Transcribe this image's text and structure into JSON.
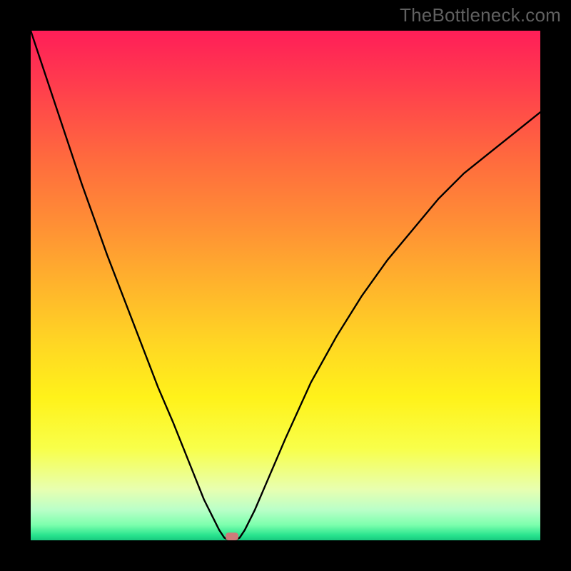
{
  "meta": {
    "watermark": "TheBottleneck.com"
  },
  "chart_data": {
    "type": "line",
    "title": "",
    "xlabel": "",
    "ylabel": "",
    "xlim": [
      0,
      100
    ],
    "ylim": [
      0,
      100
    ],
    "grid": false,
    "legend": false,
    "background_gradient": {
      "direction": "vertical",
      "stops": [
        {
          "pos": 0.0,
          "color": "#ff1e58"
        },
        {
          "pos": 0.1,
          "color": "#ff3b4e"
        },
        {
          "pos": 0.25,
          "color": "#ff6a3e"
        },
        {
          "pos": 0.38,
          "color": "#ff8f35"
        },
        {
          "pos": 0.5,
          "color": "#ffb42c"
        },
        {
          "pos": 0.62,
          "color": "#ffd823"
        },
        {
          "pos": 0.72,
          "color": "#fff21a"
        },
        {
          "pos": 0.82,
          "color": "#f8ff4a"
        },
        {
          "pos": 0.9,
          "color": "#e8ffb0"
        },
        {
          "pos": 0.94,
          "color": "#baffc8"
        },
        {
          "pos": 0.97,
          "color": "#7cffad"
        },
        {
          "pos": 0.99,
          "color": "#28e38e"
        },
        {
          "pos": 1.0,
          "color": "#18c97f"
        }
      ]
    },
    "series": [
      {
        "name": "bottleneck-curve",
        "color": "#000000",
        "stroke_width": 2.4,
        "x": [
          0,
          5,
          10,
          15,
          20,
          25,
          28,
          30,
          32,
          34,
          36,
          37,
          38,
          39,
          40,
          41,
          42,
          44,
          47,
          50,
          55,
          60,
          65,
          70,
          75,
          80,
          85,
          90,
          95,
          100
        ],
        "y": [
          100,
          85,
          70,
          56,
          43,
          30,
          23,
          18,
          13,
          8,
          4,
          2,
          0.5,
          0,
          0,
          0.5,
          2,
          6,
          13,
          20,
          31,
          40,
          48,
          55,
          61,
          67,
          72,
          76,
          80,
          84
        ]
      }
    ],
    "markers": [
      {
        "name": "bottleneck-point",
        "shape": "rounded-rect",
        "color": "#cd7a7a",
        "x": 39.5,
        "y": 0,
        "width_pct": 2.5,
        "height_pct": 1.5
      }
    ]
  }
}
